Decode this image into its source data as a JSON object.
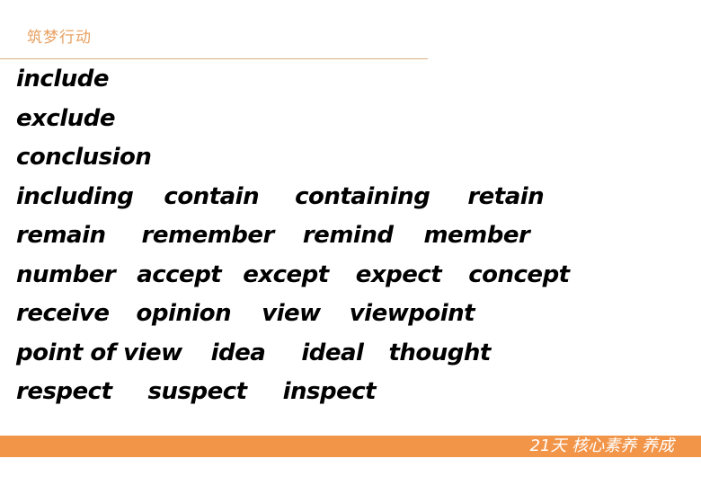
{
  "header": {
    "title": "筑梦行动"
  },
  "lines": [
    [
      "include"
    ],
    [
      "exclude"
    ],
    [
      "conclusion"
    ],
    [
      "including",
      "contain",
      "containing",
      "retain"
    ],
    [
      "remain",
      "remember",
      "remind",
      "member"
    ],
    [
      "number",
      "accept",
      "except",
      "expect",
      "concept"
    ],
    [
      "receive",
      "opinion",
      "view",
      "viewpoint"
    ],
    [
      "point of view",
      "idea",
      "ideal",
      "thought"
    ],
    [
      "respect",
      "suspect",
      "inspect"
    ]
  ],
  "footer": {
    "slogan": "21天  核心素养  养成"
  },
  "colors": {
    "accent": "#f29549",
    "header_text": "#e8a060",
    "rule": "#d8b080",
    "body_text": "#000000"
  }
}
